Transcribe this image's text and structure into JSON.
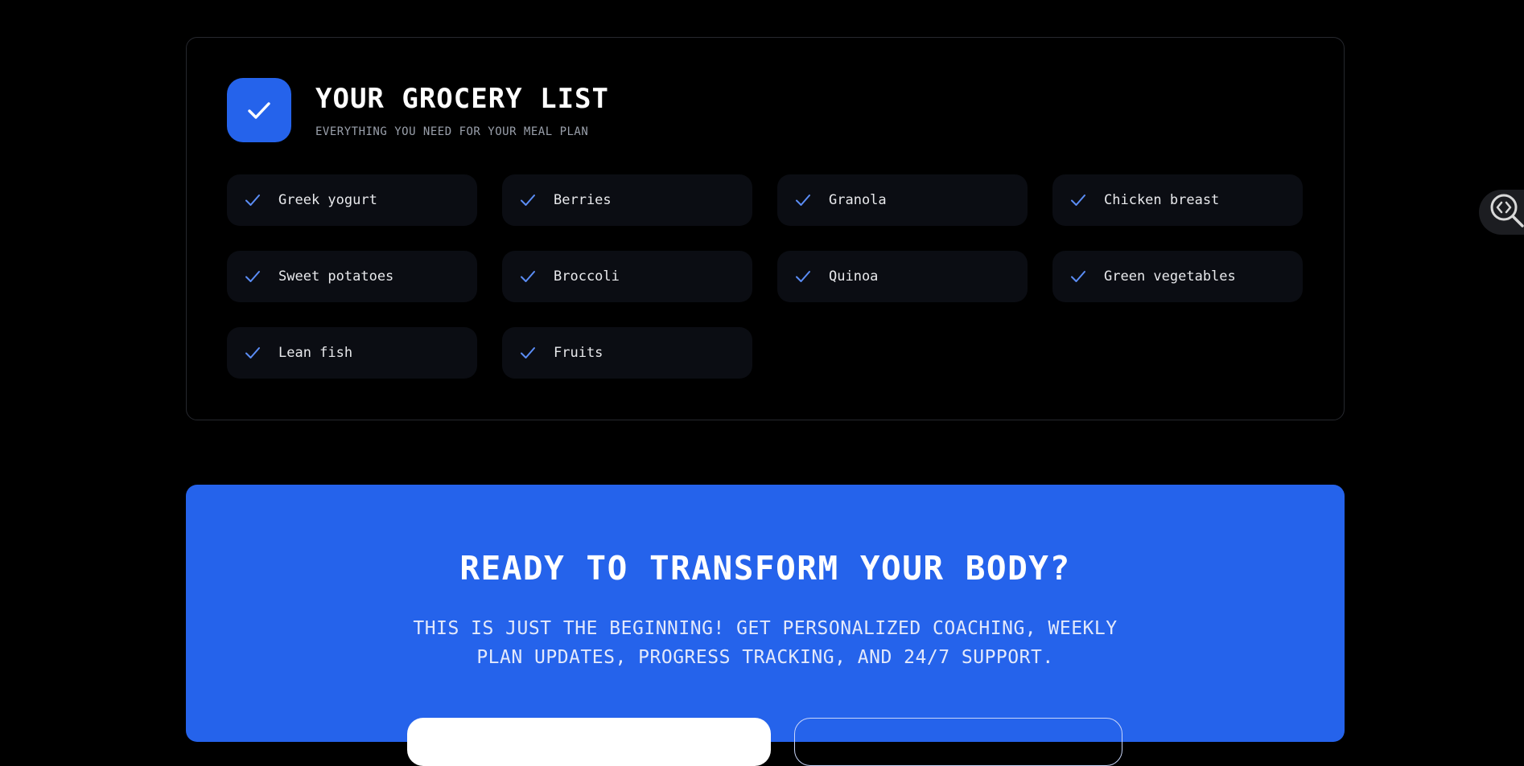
{
  "grocery": {
    "title": "YOUR GROCERY LIST",
    "subtitle": "EVERYTHING YOU NEED FOR YOUR MEAL PLAN",
    "header_icon": "check-icon",
    "items": [
      "Greek yogurt",
      "Berries",
      "Granola",
      "Chicken breast",
      "Sweet potatoes",
      "Broccoli",
      "Quinoa",
      "Green vegetables",
      "Lean fish",
      "Fruits"
    ]
  },
  "cta": {
    "title": "READY TO TRANSFORM YOUR BODY?",
    "text": "THIS IS JUST THE BEGINNING! GET PERSONALIZED COACHING, WEEKLY PLAN UPDATES, PROGRESS TRACKING, AND 24/7 SUPPORT."
  },
  "devtools": {
    "icon": "code-search-icon"
  },
  "colors": {
    "accent": "#2563eb",
    "background": "#000000",
    "item_bg": "#0b0d13",
    "check": "#5b8df6"
  }
}
